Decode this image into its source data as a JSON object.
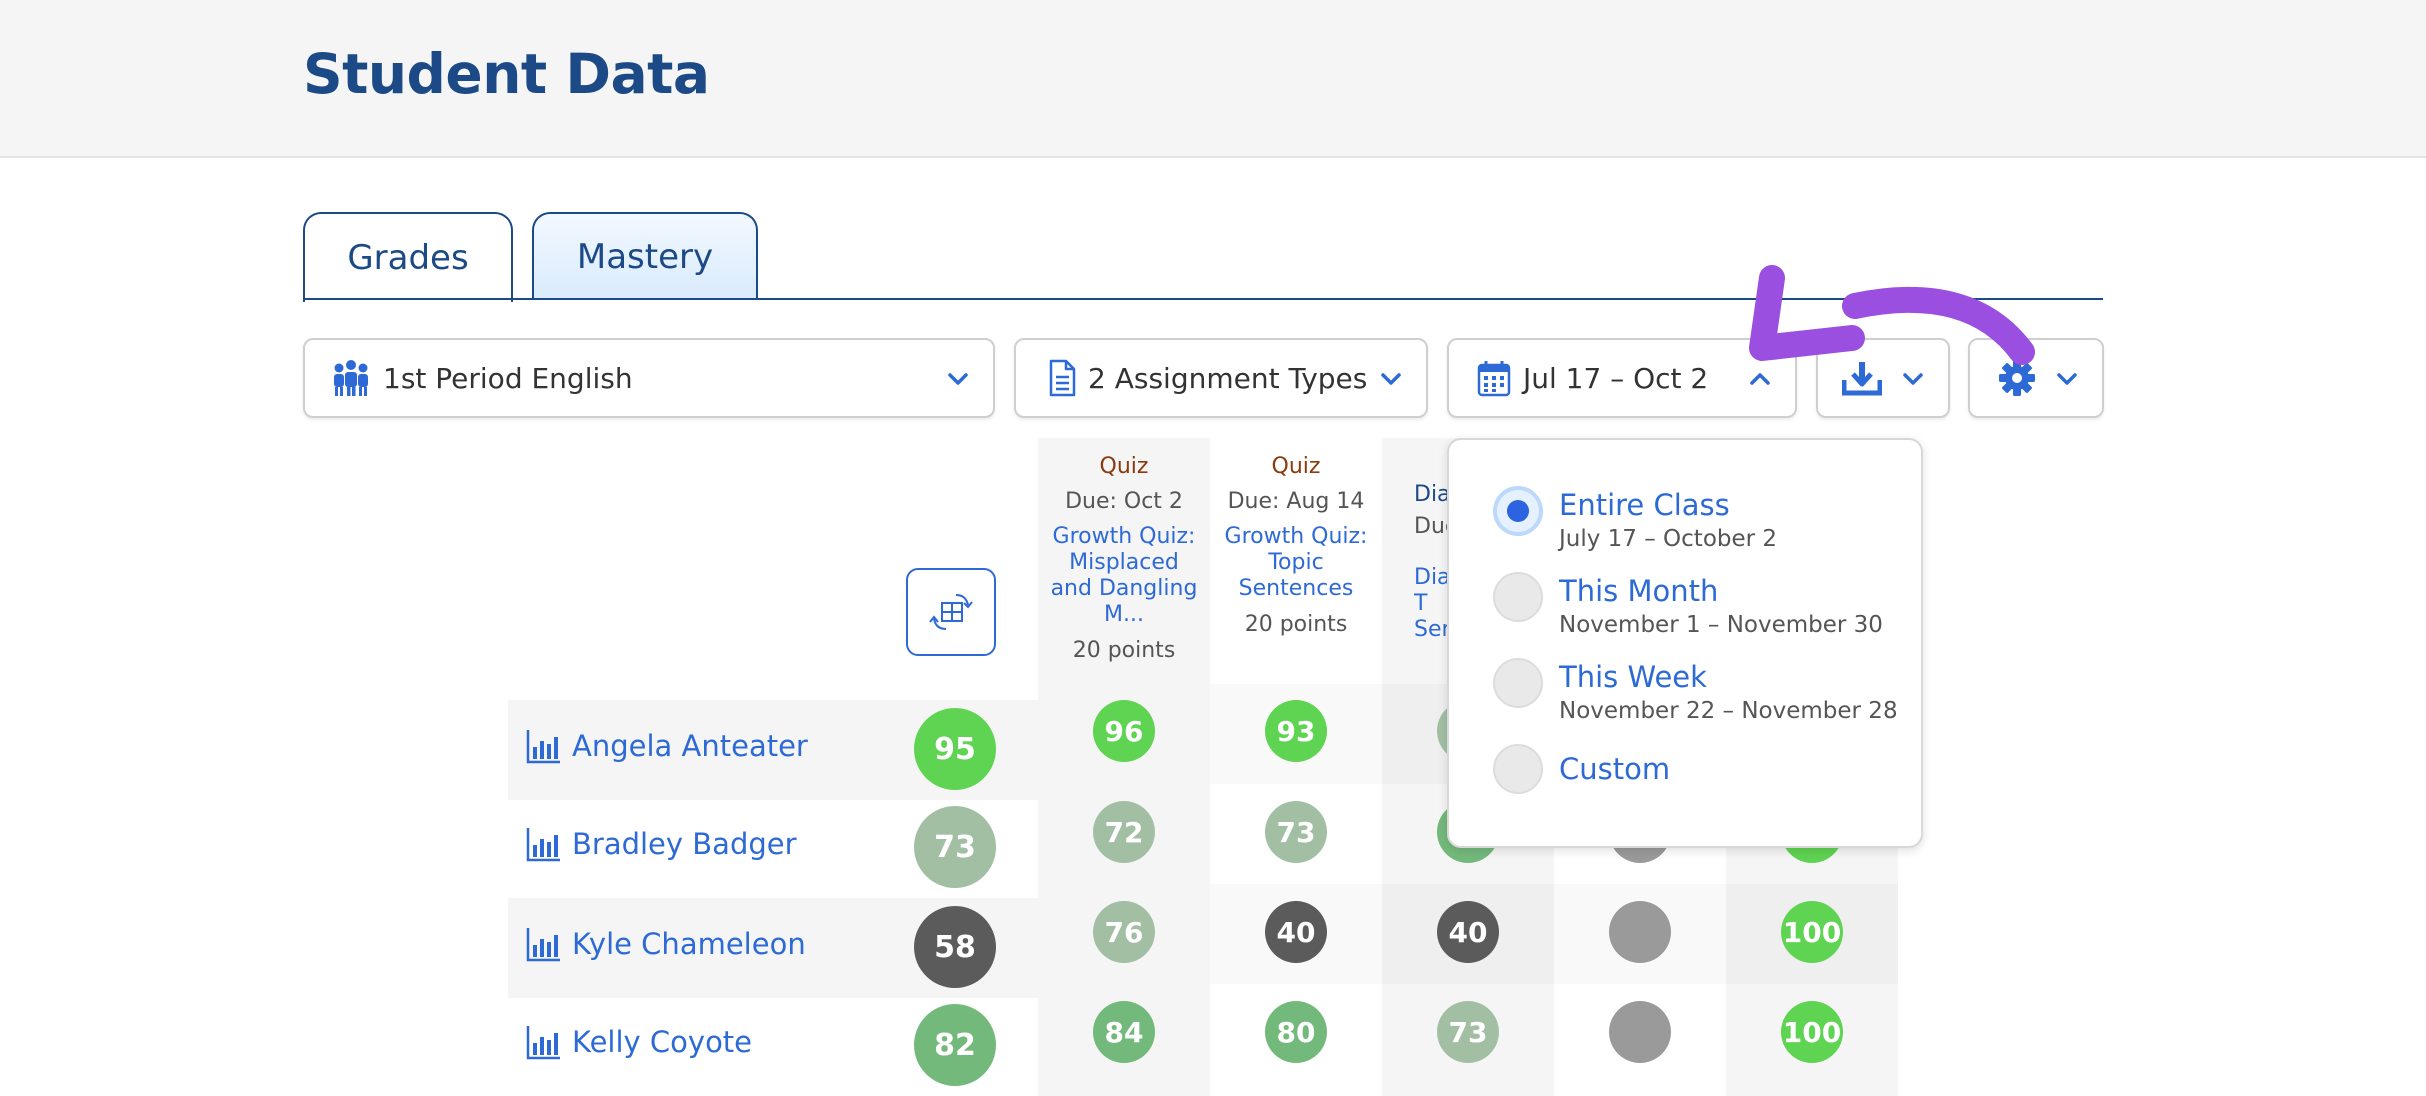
{
  "page": {
    "title": "Student Data"
  },
  "tabs": [
    {
      "label": "Grades"
    },
    {
      "label": "Mastery"
    }
  ],
  "toolbar": {
    "class_select": {
      "label": "1st Period English",
      "icon": "people-icon"
    },
    "assignment_select": {
      "label": "2 Assignment Types",
      "icon": "document-icon"
    },
    "date_select": {
      "label": "Jul 17 – Oct 2",
      "icon": "calendar-icon"
    },
    "download": {
      "icon": "download-icon"
    },
    "settings": {
      "icon": "gear-icon"
    }
  },
  "columns": [
    {
      "type": "Quiz",
      "due": "Due: Oct 2",
      "title": "Growth Quiz: Misplaced and Dangling M...",
      "points": "20 points"
    },
    {
      "type": "Quiz",
      "due": "Due: Aug 14",
      "title": "Growth Quiz: Topic Sentences",
      "points": "20 points"
    },
    {
      "type": "Dia",
      "due": "Due",
      "title": "Dia T Sen",
      "points": ""
    }
  ],
  "students": [
    {
      "name": "Angela Anteater",
      "average": "95",
      "scores": [
        "96",
        "93",
        "",
        "",
        ""
      ]
    },
    {
      "name": "Bradley Badger",
      "average": "73",
      "scores": [
        "72",
        "73",
        "",
        "",
        ""
      ]
    },
    {
      "name": "Kyle Chameleon",
      "average": "58",
      "scores": [
        "76",
        "40",
        "40",
        "",
        "100"
      ]
    },
    {
      "name": "Kelly Coyote",
      "average": "82",
      "scores": [
        "84",
        "80",
        "73",
        "",
        "100"
      ]
    }
  ],
  "date_menu": {
    "options": [
      {
        "title": "Entire Class",
        "subtitle": "July 17 – October 2",
        "selected": true
      },
      {
        "title": "This Month",
        "subtitle": "November 1 – November 30",
        "selected": false
      },
      {
        "title": "This Week",
        "subtitle": "November 22 – November 28",
        "selected": false
      },
      {
        "title": "Custom",
        "subtitle": "",
        "selected": false
      }
    ]
  },
  "colors": {
    "brand_blue": "#1c4a86",
    "link_blue": "#2d6ad6",
    "score_high": "#5fd352",
    "score_mid": "#74b97c",
    "score_low": "#a2bfa4",
    "score_fail": "#5b5b5b",
    "score_missing": "#9a9a9a",
    "annotation_arrow": "#9a4fe0"
  }
}
